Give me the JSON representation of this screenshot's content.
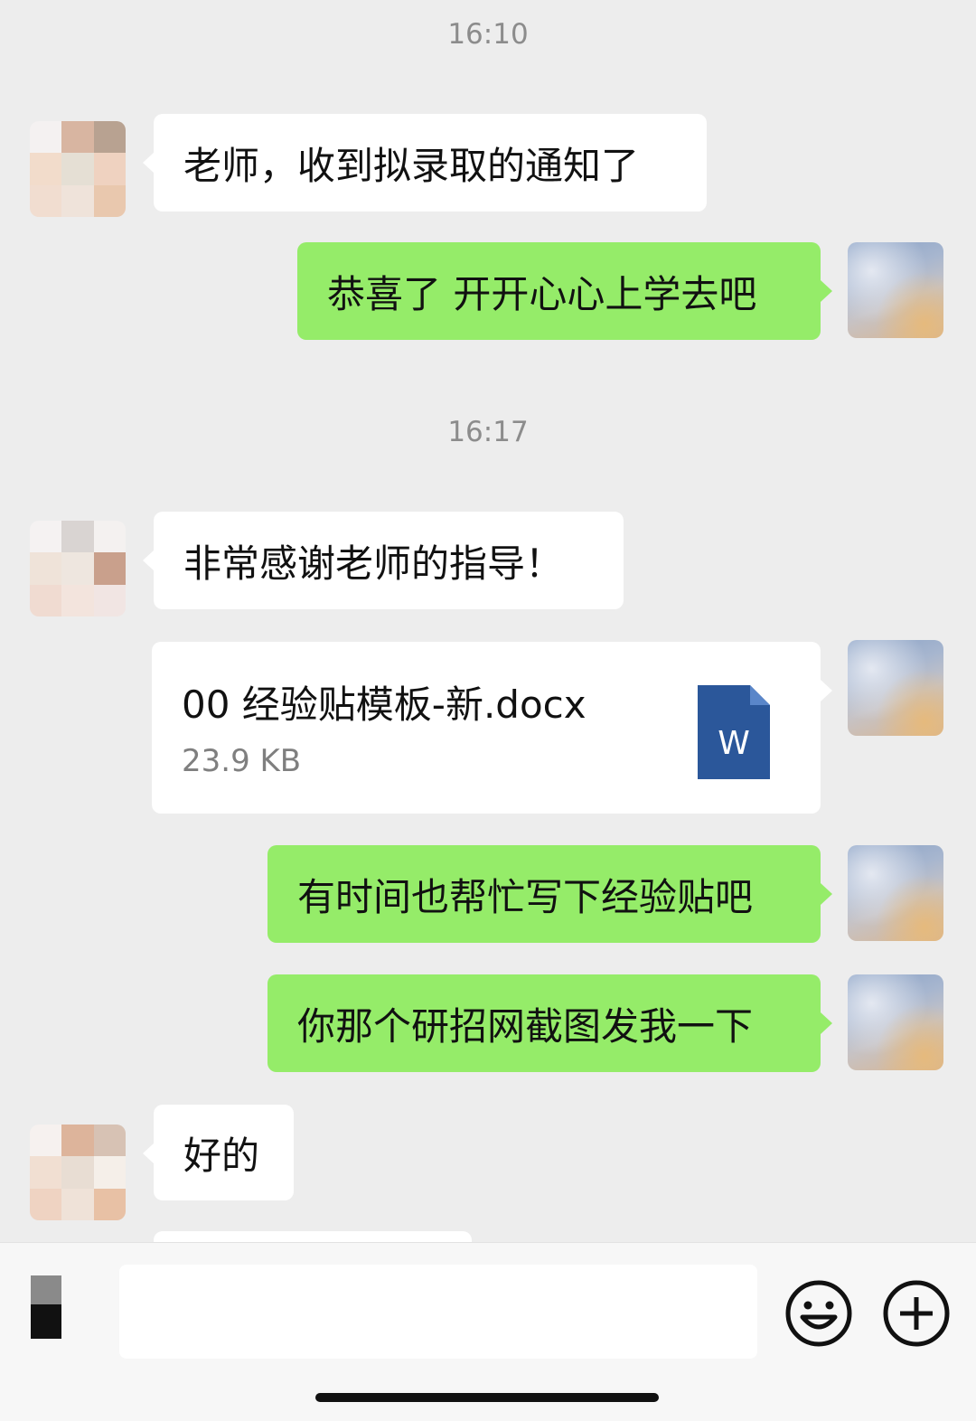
{
  "colors": {
    "background": "#ededed",
    "outgoing_bubble": "#95ec69",
    "incoming_bubble": "#ffffff",
    "word_icon": "#2b579a"
  },
  "chat": {
    "timestamps": [
      "16:10",
      "16:17"
    ],
    "messages": [
      {
        "side": "incoming",
        "text": "老师，收到拟录取的通知了"
      },
      {
        "side": "outgoing",
        "text": "恭喜了 开开心心上学去吧"
      },
      {
        "side": "incoming",
        "text": "非常感谢老师的指导！"
      },
      {
        "side": "outgoing",
        "type": "file",
        "file_name": "00 经验贴模板-新.docx",
        "file_size": "23.9 KB",
        "icon": "word-doc-icon",
        "icon_letter": "W"
      },
      {
        "side": "outgoing",
        "text": "有时间也帮忙写下经验贴吧"
      },
      {
        "side": "outgoing",
        "text": "你那个研招网截图发我一下"
      },
      {
        "side": "incoming",
        "text": "好的"
      }
    ]
  },
  "input_bar": {
    "voice_icon": "voice-icon",
    "text_value": "",
    "emoji_icon": "emoji-icon",
    "plus_icon": "plus-icon"
  }
}
